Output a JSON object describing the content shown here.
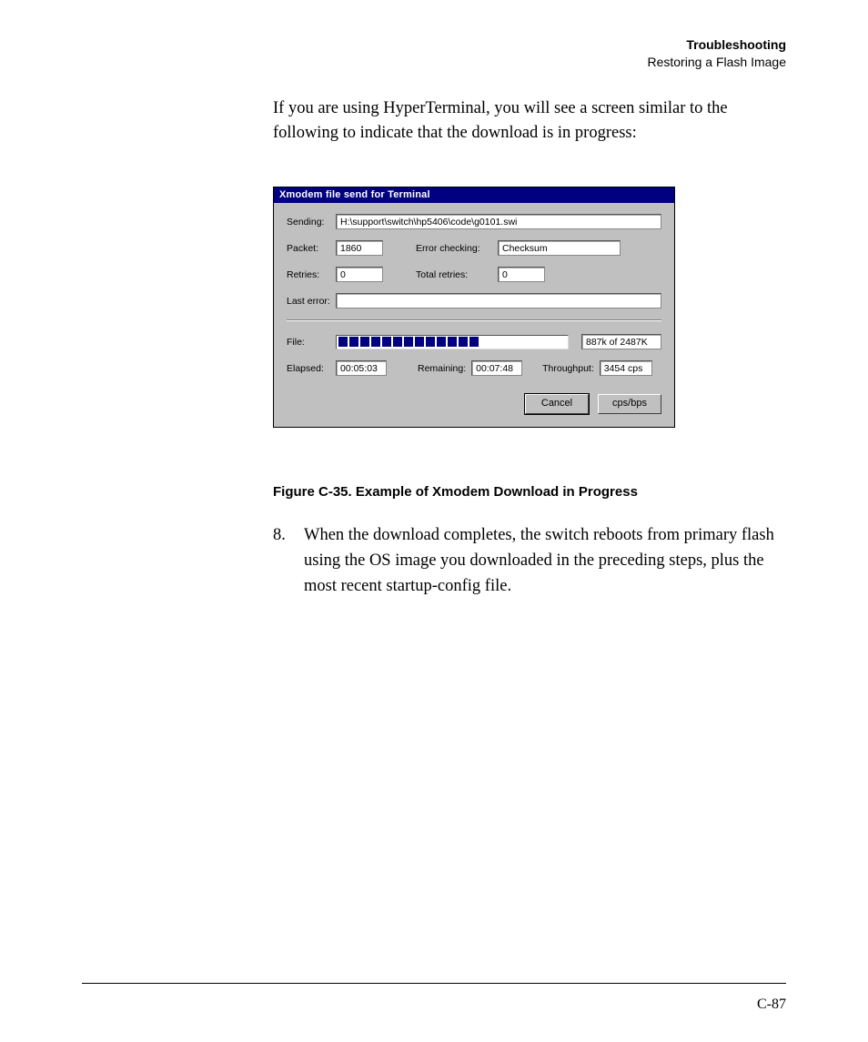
{
  "header": {
    "section": "Troubleshooting",
    "subsection": "Restoring a Flash Image"
  },
  "intro": "If you are using HyperTerminal, you will see a screen similar to the following to indicate that the download is in progress:",
  "dialog": {
    "title": "Xmodem file send for Terminal",
    "labels": {
      "sending": "Sending:",
      "packet": "Packet:",
      "error_checking": "Error checking:",
      "retries": "Retries:",
      "total_retries": "Total retries:",
      "last_error": "Last error:",
      "file": "File:",
      "elapsed": "Elapsed:",
      "remaining": "Remaining:",
      "throughput": "Throughput:"
    },
    "values": {
      "sending": "H:\\support\\switch\\hp5406\\code\\g0101.swi",
      "packet": "1860",
      "error_checking": "Checksum",
      "retries": "0",
      "total_retries": "0",
      "last_error": "",
      "file_progress_text": "887k of 2487K",
      "elapsed": "00:05:03",
      "remaining": "00:07:48",
      "throughput": "3454 cps"
    },
    "buttons": {
      "cancel": "Cancel",
      "cpsbps": "cps/bps"
    }
  },
  "figure_caption": "Figure C-35. Example of Xmodem Download in Progress",
  "step": {
    "number": "8.",
    "text": "When the download completes, the switch reboots from primary flash using the OS image you downloaded in the preceding steps, plus the most recent startup-config file."
  },
  "page_number": "C-87"
}
